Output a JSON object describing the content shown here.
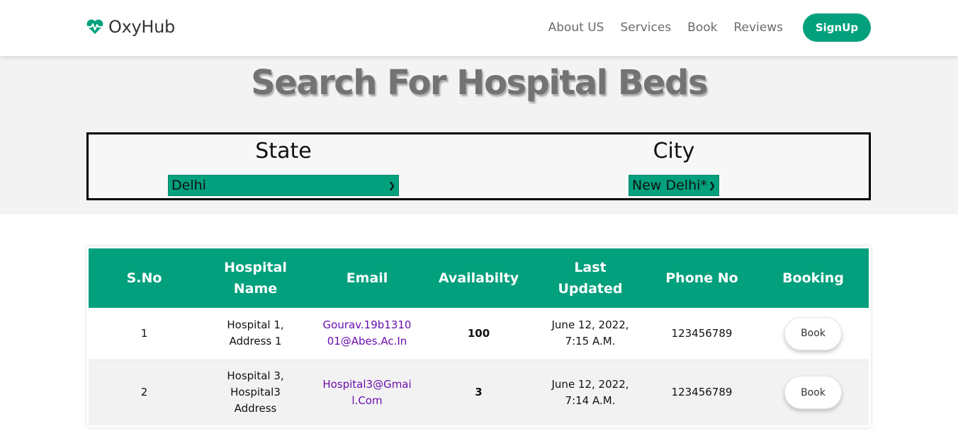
{
  "brand": {
    "name": "OxyHub",
    "icon": "heart-pulse-icon",
    "color": "#02a07d"
  },
  "nav": {
    "links": [
      "About US",
      "Services",
      "Book",
      "Reviews"
    ],
    "signup_label": "SignUp"
  },
  "search": {
    "title": "Search For Hospital Beds",
    "state_label": "State",
    "state_value": "Delhi",
    "city_label": "City",
    "city_value": "New Delhi*"
  },
  "table": {
    "headers": [
      "S.No",
      "Hospital Name",
      "Email",
      "Availabilty",
      "Last Updated",
      "Phone No",
      "Booking"
    ],
    "rows": [
      {
        "sno": "1",
        "name": "Hospital 1, Address 1",
        "email": "Gourav.19b131001@Abes.Ac.In",
        "availability": "100",
        "updated": "June 12, 2022, 7:15 A.M.",
        "phone": "123456789",
        "book_label": "Book"
      },
      {
        "sno": "2",
        "name": "Hospital 3, Hospital3 Address",
        "email": "Hospital3@Gmail.Com",
        "availability": "3",
        "updated": "June 12, 2022, 7:14 A.M.",
        "phone": "123456789",
        "book_label": "Book"
      }
    ]
  }
}
